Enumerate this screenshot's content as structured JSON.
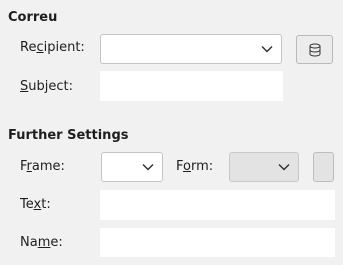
{
  "correu": {
    "title": "Correu",
    "recipient": {
      "label_pre": "Re",
      "label_accel": "c",
      "label_post": "ipient:",
      "value": ""
    },
    "address_book_button": {
      "icon": "database-icon"
    },
    "subject": {
      "label_pre": "",
      "label_accel": "S",
      "label_post": "ubject:",
      "value": ""
    }
  },
  "further": {
    "title": "Further Settings",
    "frame": {
      "label_pre": "F",
      "label_accel": "r",
      "label_post": "ame:",
      "value": ""
    },
    "form": {
      "label_pre": "F",
      "label_accel": "o",
      "label_post": "rm:",
      "value": ""
    },
    "text": {
      "label_pre": "Te",
      "label_accel": "x",
      "label_post": "t:",
      "value": ""
    },
    "name": {
      "label_pre": "Na",
      "label_accel": "m",
      "label_post": "e:",
      "value": ""
    }
  },
  "colors": {
    "background": "#f1f1f1",
    "field": "#ffffff",
    "border": "#c4c4c4"
  }
}
